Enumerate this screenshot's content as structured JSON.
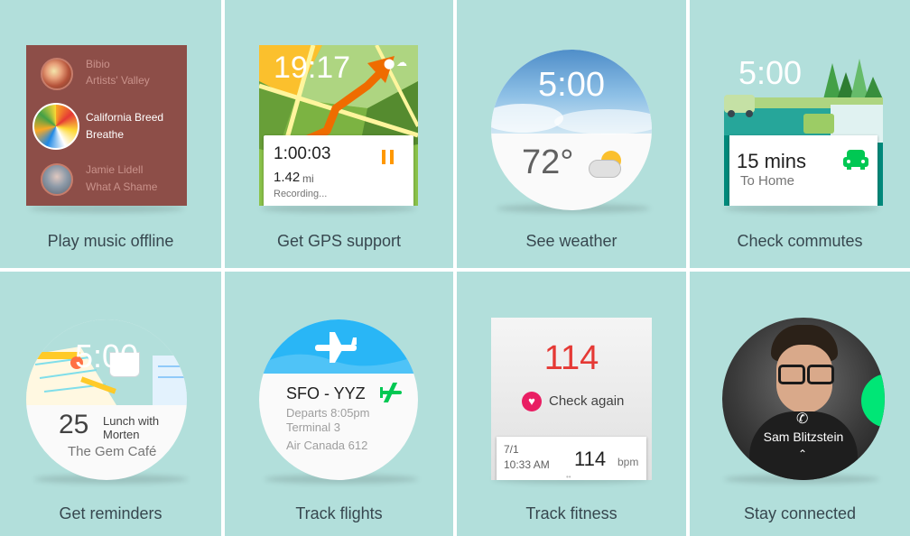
{
  "features": [
    {
      "caption": "Play music offline"
    },
    {
      "caption": "Get GPS support"
    },
    {
      "caption": "See weather"
    },
    {
      "caption": "Check commutes"
    },
    {
      "caption": "Get reminders"
    },
    {
      "caption": "Track flights"
    },
    {
      "caption": "Track fitness"
    },
    {
      "caption": "Stay connected"
    }
  ],
  "music": {
    "tracks": [
      {
        "artist": "Bibio",
        "title": "Artists' Valley"
      },
      {
        "artist": "California Breed",
        "title": "Breathe"
      },
      {
        "artist": "Jamie Lidell",
        "title": "What A Shame"
      }
    ],
    "background": "#8d4e48"
  },
  "gps": {
    "time": "19:17",
    "elapsed": "1:00:03",
    "distance": "1.42",
    "unit": "mi",
    "status": "Recording...",
    "accent": "#ff9800"
  },
  "weather": {
    "time": "5:00",
    "temperature": "72°"
  },
  "commute": {
    "time": "5:00",
    "duration": "15 mins",
    "destination": "To Home",
    "accent": "#00c853"
  },
  "reminder": {
    "time": "5:00",
    "day": "25",
    "title": "Lunch with Morten",
    "title_line1": "Lunch with",
    "title_line2": "Morten",
    "place": "The Gem Café"
  },
  "flight": {
    "route": "SFO - YYZ",
    "departs": "Departs 8:05pm",
    "terminal": "Terminal 3",
    "airline": "Air Canada 612",
    "accent": "#00c853",
    "banner": "#29b6f6"
  },
  "fitness": {
    "value": "114",
    "action": "Check again",
    "date": "7/1",
    "time": "10:33 AM",
    "bpm_value": "114",
    "bpm_unit": "bpm",
    "accent": "#e91e63"
  },
  "contact": {
    "name": "Sam Blitzstein",
    "accent": "#00e676"
  }
}
